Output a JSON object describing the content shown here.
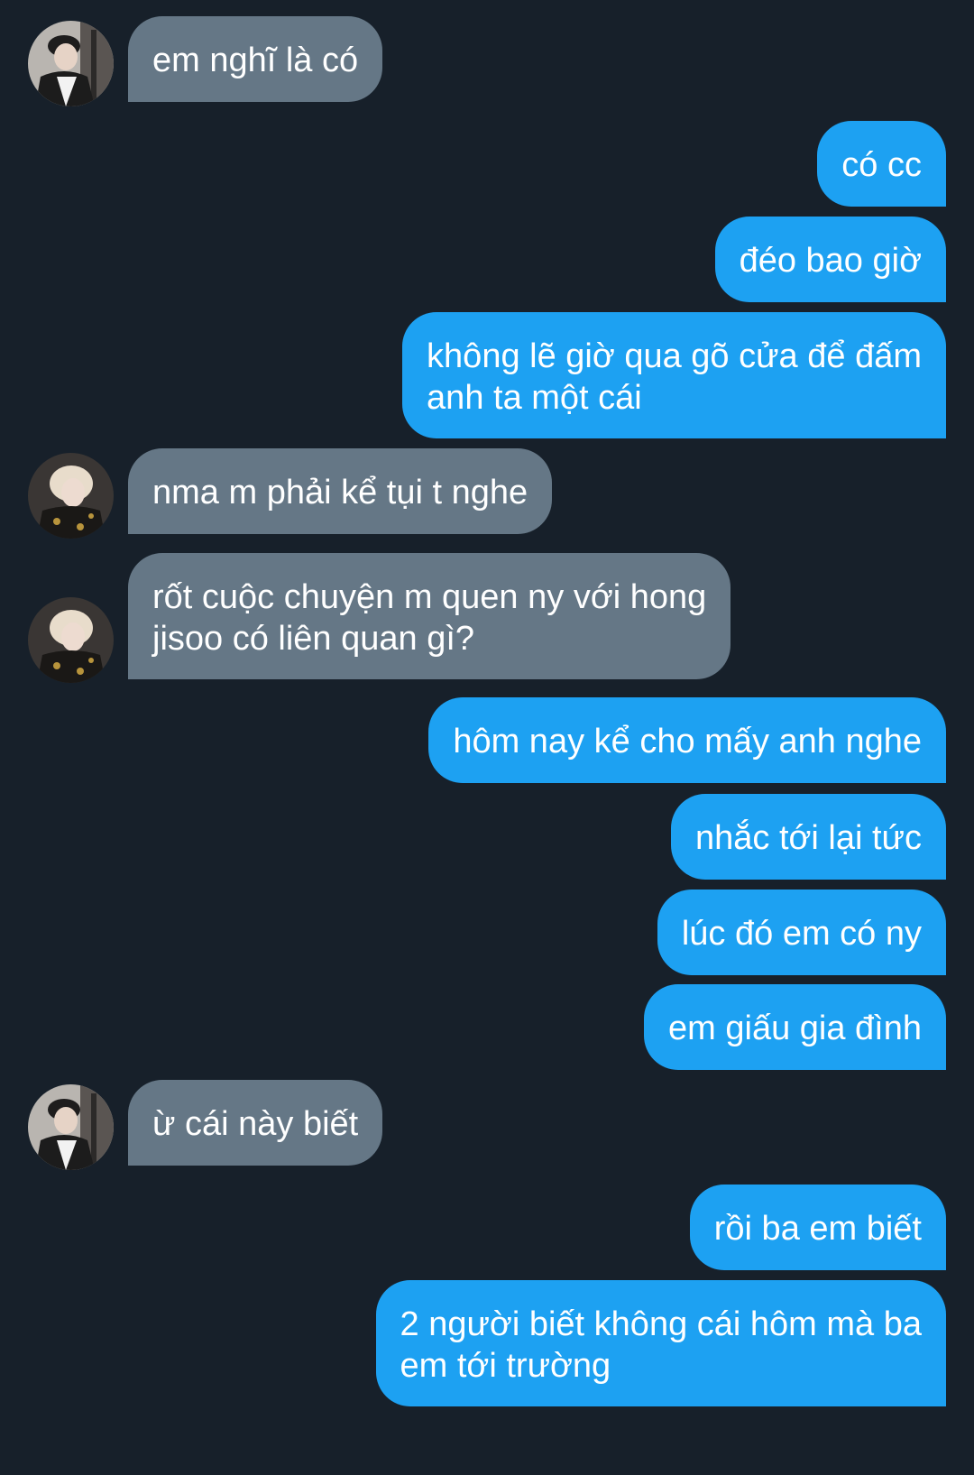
{
  "conversation": {
    "messages": [
      {
        "sender": "other-1",
        "text": "em nghĩ là có"
      },
      {
        "sender": "me",
        "text": "có cc"
      },
      {
        "sender": "me",
        "text": "đéo bao giờ"
      },
      {
        "sender": "me",
        "lines": [
          "không lẽ giờ qua gõ cửa để đấm",
          "anh ta một cái"
        ]
      },
      {
        "sender": "other-2",
        "text": "nma m phải kể tụi t nghe"
      },
      {
        "sender": "other-2",
        "lines": [
          "rốt cuộc chuyện m quen ny với hong",
          "jisoo có liên quan gì?"
        ]
      },
      {
        "sender": "me",
        "text": "hôm nay kể cho mấy anh nghe"
      },
      {
        "sender": "me",
        "text": "nhắc tới lại tức"
      },
      {
        "sender": "me",
        "text": "lúc đó em có ny"
      },
      {
        "sender": "me",
        "text": "em giấu gia đình"
      },
      {
        "sender": "other-1",
        "text": "ừ cái này biết"
      },
      {
        "sender": "me",
        "text": "rồi ba em biết"
      },
      {
        "sender": "me",
        "lines": [
          "2 người biết không cái hôm mà ba",
          "em tới trường"
        ]
      }
    ]
  },
  "colors": {
    "background": "#17202a",
    "incoming_bubble": "#657786",
    "outgoing_bubble": "#1da1f2",
    "text": "#ffffff"
  }
}
